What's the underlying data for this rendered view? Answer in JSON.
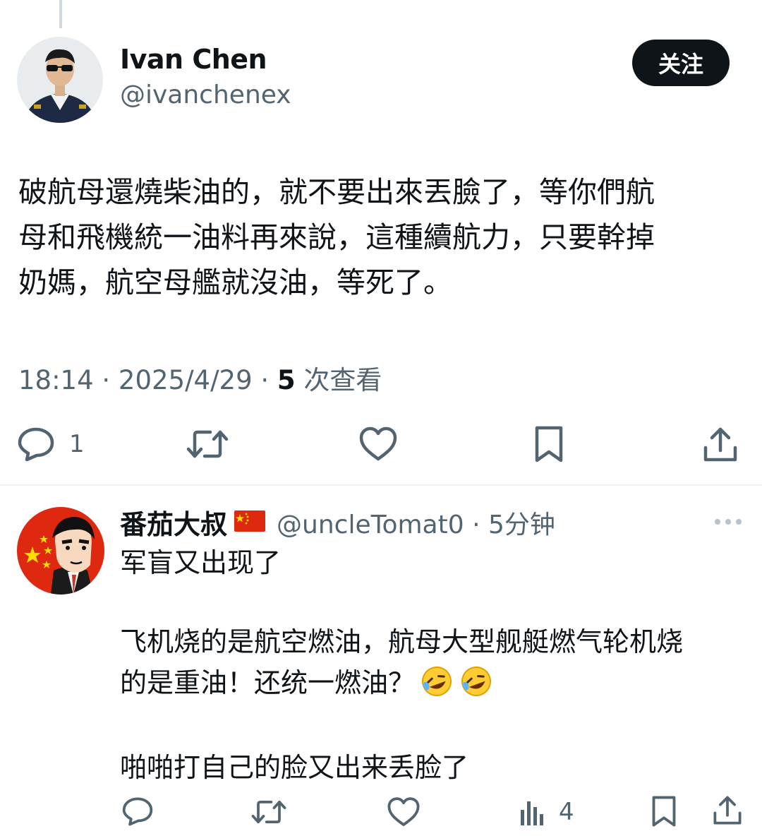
{
  "tweet": {
    "author_name": "Ivan Chen",
    "author_handle": "@ivanchenex",
    "follow_label": "关注",
    "text": "破航母還燒柴油的，就不要出來丟臉了，等你們航\n母和飛機統一油料再來說，這種續航力，只要幹掉\n奶媽，航空母艦就沒油，等死了。",
    "time": "18:14 · 2025/4/29 · ",
    "views_count": "5",
    "views_label": " 次查看",
    "actions": {
      "reply_count": "1",
      "retweet_count": "",
      "like_count": ""
    }
  },
  "reply": {
    "author_name": "番茄大叔",
    "author_handle": "@uncleTomat0 · 5分钟",
    "lines": [
      "军盲又出现了",
      "飞机烧的是航空燃油，航母大型舰艇燃气轮机烧",
      "的是重油！还统一燃油？",
      "啪啪打自己的脸又出来丢脸了"
    ],
    "actions": {
      "views_count": "4"
    }
  },
  "colors": {
    "text_primary": "#0f1419",
    "text_secondary": "#536471",
    "follow_bg": "#0f1419",
    "divider": "#eff3f4"
  },
  "icons": [
    "reply-icon",
    "retweet-icon",
    "like-icon",
    "bookmark-icon",
    "share-icon",
    "views-icon",
    "more-icon",
    "china-flag-icon",
    "rofl-emoji"
  ]
}
